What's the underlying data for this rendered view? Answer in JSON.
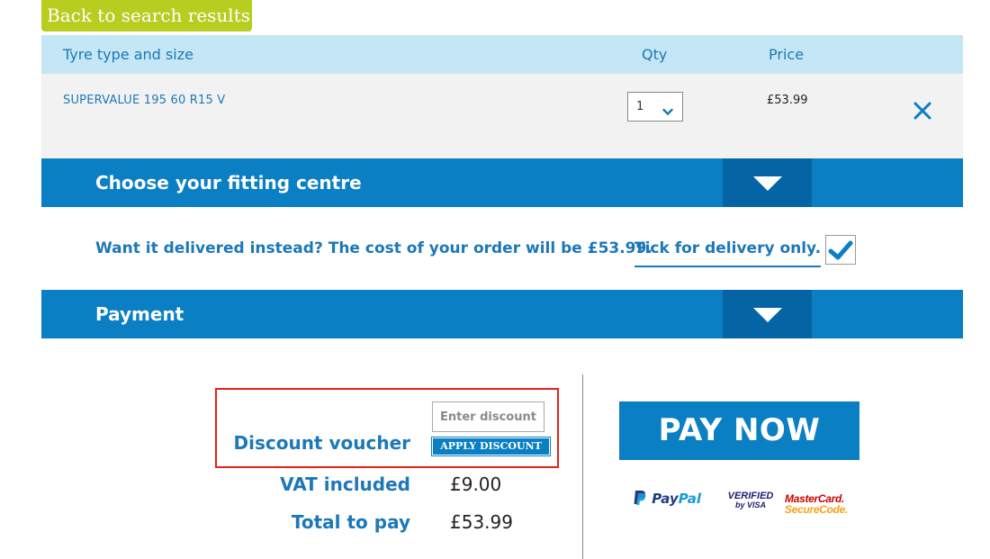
{
  "nav": {
    "back_label": "Back to search results"
  },
  "table": {
    "headers": {
      "product": "Tyre type and size",
      "qty": "Qty",
      "price": "Price"
    },
    "items": [
      {
        "name": "SUPERVALUE 195 60 R15 V",
        "qty": "1",
        "price": "£53.99",
        "remove_icon": "close-icon"
      }
    ]
  },
  "fitting_panel": {
    "title": "Choose your fitting centre",
    "toggle_icon": "triangle-down-icon"
  },
  "delivery": {
    "text": "Want it delivered instead? The cost of your order will be £53.99.",
    "link": "Tick for delivery only.",
    "checked": true
  },
  "payment_panel": {
    "title": "Payment",
    "toggle_icon": "triangle-down-icon"
  },
  "summary": {
    "discount_label": "Discount voucher",
    "discount_placeholder": "Enter discount code",
    "apply_label": "APPLY DISCOUNT",
    "vat_label": "VAT included",
    "vat_value": "£9.00",
    "total_label": "Total to pay",
    "total_value": "£53.99"
  },
  "pay_button": "PAY NOW",
  "payment_logos": {
    "paypal": [
      "Pay",
      "Pal"
    ],
    "visa": [
      "VERIFIED",
      "by VISA"
    ],
    "mastercard": [
      "MasterCard.",
      "SecureCode."
    ]
  },
  "colors": {
    "brand_blue": "#0a7fc3",
    "dark_blue": "#0565a4",
    "text_blue": "#1c78b8",
    "header_bg": "#c5e6f5",
    "back_green": "#b7cd1f",
    "highlight_red": "#e2231a"
  }
}
